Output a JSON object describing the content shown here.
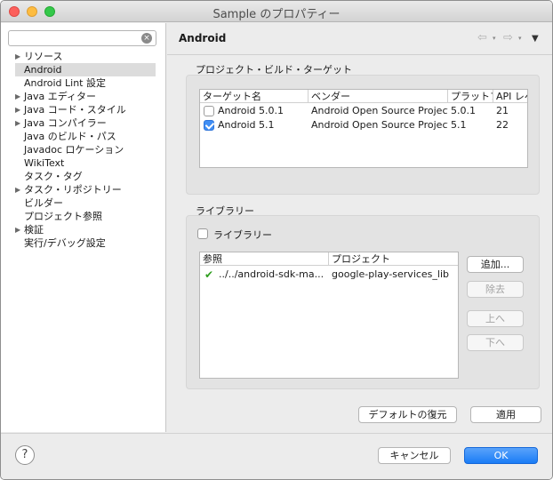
{
  "window": {
    "title": "Sample のプロパティー"
  },
  "filter": {
    "value": "",
    "placeholder": ""
  },
  "tree": {
    "items": [
      {
        "label": "リソース",
        "expandable": true,
        "selected": false
      },
      {
        "label": "Android",
        "expandable": false,
        "selected": true
      },
      {
        "label": "Android Lint 設定",
        "expandable": false,
        "selected": false
      },
      {
        "label": "Java エディター",
        "expandable": true,
        "selected": false
      },
      {
        "label": "Java コード・スタイル",
        "expandable": true,
        "selected": false
      },
      {
        "label": "Java コンパイラー",
        "expandable": true,
        "selected": false
      },
      {
        "label": "Java のビルド・パス",
        "expandable": false,
        "selected": false
      },
      {
        "label": "Javadoc ロケーション",
        "expandable": false,
        "selected": false
      },
      {
        "label": "WikiText",
        "expandable": false,
        "selected": false
      },
      {
        "label": "タスク・タグ",
        "expandable": false,
        "selected": false
      },
      {
        "label": "タスク・リポジトリー",
        "expandable": true,
        "selected": false
      },
      {
        "label": "ビルダー",
        "expandable": false,
        "selected": false
      },
      {
        "label": "プロジェクト参照",
        "expandable": false,
        "selected": false
      },
      {
        "label": "検証",
        "expandable": true,
        "selected": false
      },
      {
        "label": "実行/デバッグ設定",
        "expandable": false,
        "selected": false
      }
    ]
  },
  "page": {
    "title": "Android"
  },
  "build_target": {
    "group_label": "プロジェクト・ビルド・ターゲット",
    "columns": [
      "ターゲット名",
      "ベンダー",
      "プラットフォーム",
      "API レベル"
    ],
    "rows": [
      {
        "name": "Android 5.0.1",
        "vendor": "Android Open Source Project",
        "platform": "5.0.1",
        "api": "21",
        "checked": false
      },
      {
        "name": "Android 5.1",
        "vendor": "Android Open Source Project",
        "platform": "5.1",
        "api": "22",
        "checked": true
      }
    ]
  },
  "library": {
    "group_label": "ライブラリー",
    "is_library_label": "ライブラリー",
    "is_library_checked": false,
    "columns": [
      "参照",
      "プロジェクト"
    ],
    "rows": [
      {
        "reference": "../../android-sdk-ma...",
        "project": "google-play-services_lib"
      }
    ],
    "buttons": {
      "add": "追加...",
      "remove": "除去",
      "up": "上へ",
      "down": "下へ"
    }
  },
  "actions": {
    "restore_defaults": "デフォルトの復元",
    "apply": "適用",
    "cancel": "キャンセル",
    "ok": "OK"
  },
  "icons": {
    "help": "?",
    "clear": "×",
    "expand": "▶",
    "back": "⇦",
    "forward": "⇨",
    "dropdown": "▾",
    "view_menu": "▼",
    "check": "✔"
  },
  "colors": {
    "accent": "#1a7cf6",
    "check_green": "#2f9e1f"
  }
}
